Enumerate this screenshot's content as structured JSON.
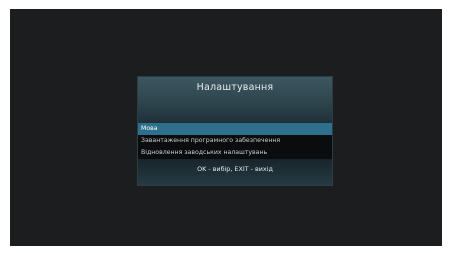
{
  "dialog": {
    "title": "Налаштування",
    "footer_hint": "OK - вибір, EXIT - вихід"
  },
  "menu": {
    "selected_index": 0,
    "items": [
      {
        "label": "Мова"
      },
      {
        "label": "Завантаження програмного забезпечення"
      },
      {
        "label": "Відновлення заводських налаштувань"
      }
    ]
  },
  "colors": {
    "screen_background": "#1b1d1e",
    "header_gradient_top": "#3d565f",
    "selection_highlight": "#2e6f8b",
    "menu_background": "#0a0c0d"
  }
}
